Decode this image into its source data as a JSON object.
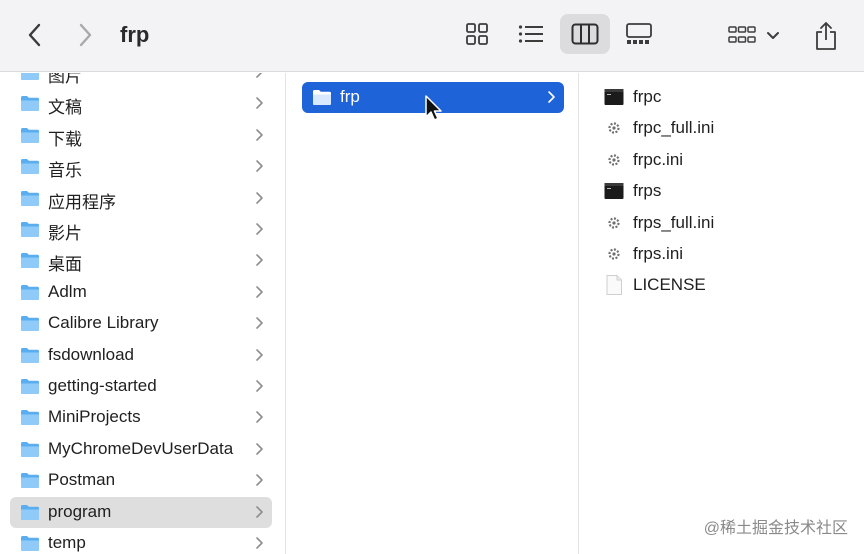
{
  "toolbar": {
    "title": "frp",
    "view_modes": [
      "icons",
      "list",
      "columns",
      "gallery"
    ],
    "active_view": "columns"
  },
  "column1": {
    "items": [
      {
        "label": "图片",
        "icon": "folder-pictures-icon"
      },
      {
        "label": "文稿",
        "icon": "folder-documents-icon"
      },
      {
        "label": "下载",
        "icon": "folder-downloads-icon"
      },
      {
        "label": "音乐",
        "icon": "folder-music-icon"
      },
      {
        "label": "应用程序",
        "icon": "folder-applications-icon"
      },
      {
        "label": "影片",
        "icon": "folder-movies-icon"
      },
      {
        "label": "桌面",
        "icon": "folder-desktop-icon"
      },
      {
        "label": "Adlm",
        "icon": "folder-icon"
      },
      {
        "label": "Calibre Library",
        "icon": "folder-icon"
      },
      {
        "label": "fsdownload",
        "icon": "folder-icon"
      },
      {
        "label": "getting-started",
        "icon": "folder-icon"
      },
      {
        "label": "MiniProjects",
        "icon": "folder-icon"
      },
      {
        "label": "MyChromeDevUserData",
        "icon": "folder-icon"
      },
      {
        "label": "Postman",
        "icon": "folder-icon"
      },
      {
        "label": "program",
        "icon": "folder-icon",
        "selected": true
      },
      {
        "label": "temp",
        "icon": "folder-icon"
      }
    ]
  },
  "column2": {
    "items": [
      {
        "label": "frp",
        "icon": "folder-icon",
        "selected": true
      }
    ]
  },
  "column3": {
    "items": [
      {
        "label": "frpc",
        "icon": "executable-icon"
      },
      {
        "label": "frpc_full.ini",
        "icon": "config-file-icon"
      },
      {
        "label": "frpc.ini",
        "icon": "config-file-icon"
      },
      {
        "label": "frps",
        "icon": "executable-icon"
      },
      {
        "label": "frps_full.ini",
        "icon": "config-file-icon"
      },
      {
        "label": "frps.ini",
        "icon": "config-file-icon"
      },
      {
        "label": "LICENSE",
        "icon": "document-icon"
      }
    ]
  },
  "watermark": "@稀土掘金技术社区",
  "colors": {
    "selection_blue": "#1f63d8",
    "selection_gray": "#dedede",
    "folder_blue": "#5aaef0",
    "toolbar_bg": "#f3f2f4"
  }
}
